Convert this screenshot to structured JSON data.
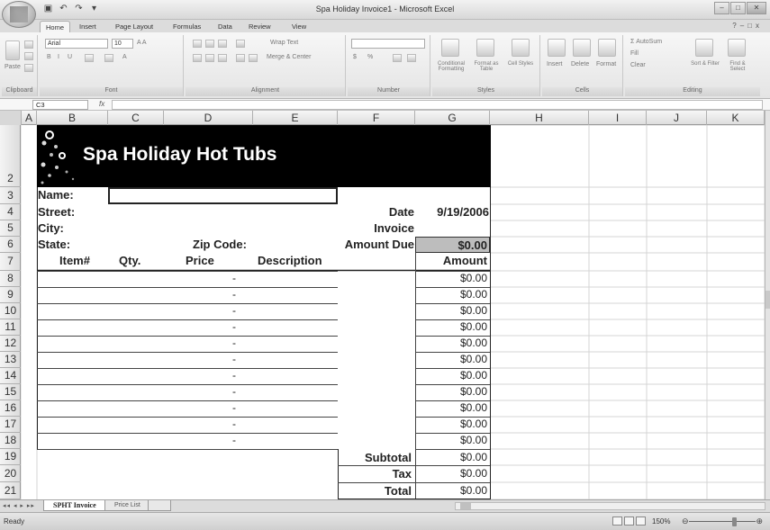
{
  "window": {
    "title": "Spa Holiday Invoice1 - Microsoft Excel",
    "qat_icons": [
      "save-icon",
      "undo-icon",
      "redo-icon",
      "customize-icon"
    ]
  },
  "ribbon": {
    "tabs": [
      "Home",
      "Insert",
      "Page Layout",
      "Formulas",
      "Data",
      "Review",
      "View"
    ],
    "active_tab": "Home",
    "groups": {
      "clipboard": {
        "label": "Clipboard",
        "paste": "Paste"
      },
      "font": {
        "label": "Font",
        "name": "Arial",
        "size": "10"
      },
      "alignment": {
        "label": "Alignment",
        "wrap": "Wrap Text",
        "merge": "Merge & Center"
      },
      "number": {
        "label": "Number",
        "format": "",
        "currency": "$",
        "percent": "%"
      },
      "styles": {
        "label": "Styles",
        "conditional": "Conditional Formatting",
        "format_table": "Format as Table",
        "cell_styles": "Cell Styles"
      },
      "cells": {
        "label": "Cells",
        "insert": "Insert",
        "delete": "Delete",
        "format": "Format"
      },
      "editing": {
        "label": "Editing",
        "autosum": "Σ AutoSum",
        "fill": "Fill",
        "clear": "Clear",
        "sort": "Sort & Filter",
        "find": "Find & Select"
      }
    }
  },
  "formula_bar": {
    "name_box": "C3",
    "fx": "fx",
    "content": ""
  },
  "columns": [
    "A",
    "B",
    "C",
    "D",
    "E",
    "F",
    "G",
    "H",
    "I",
    "J",
    "K"
  ],
  "rows": [
    "2",
    "3",
    "4",
    "5",
    "6",
    "7",
    "8",
    "9",
    "10",
    "11",
    "12",
    "13",
    "14",
    "15",
    "16",
    "17",
    "18",
    "19",
    "20",
    "21"
  ],
  "invoice": {
    "banner_title": "Spa Holiday Hot Tubs",
    "labels": {
      "name": "Name:",
      "street": "Street:",
      "city": "City:",
      "state": "State:",
      "zip": "Zip Code:",
      "date": "Date",
      "invoice": "Invoice",
      "amount_due": "Amount Due"
    },
    "date_value": "9/19/2006",
    "amount_due_value": "$0.00",
    "table_headers": [
      "Item#",
      "Qty.",
      "Price",
      "Description",
      "Amount"
    ],
    "line_items": [
      {
        "price": "-",
        "amount": "$0.00"
      },
      {
        "price": "-",
        "amount": "$0.00"
      },
      {
        "price": "-",
        "amount": "$0.00"
      },
      {
        "price": "-",
        "amount": "$0.00"
      },
      {
        "price": "-",
        "amount": "$0.00"
      },
      {
        "price": "-",
        "amount": "$0.00"
      },
      {
        "price": "-",
        "amount": "$0.00"
      },
      {
        "price": "-",
        "amount": "$0.00"
      },
      {
        "price": "-",
        "amount": "$0.00"
      },
      {
        "price": "-",
        "amount": "$0.00"
      },
      {
        "price": "-",
        "amount": "$0.00"
      }
    ],
    "totals": [
      {
        "label": "Subtotal",
        "value": "$0.00"
      },
      {
        "label": "Tax",
        "value": "$0.00"
      },
      {
        "label": "Total",
        "value": "$0.00"
      }
    ]
  },
  "sheet_tabs": [
    "SPHT Invoice",
    "Price List"
  ],
  "active_sheet": "SPHT Invoice",
  "status": {
    "ready": "Ready",
    "zoom": "150%"
  }
}
